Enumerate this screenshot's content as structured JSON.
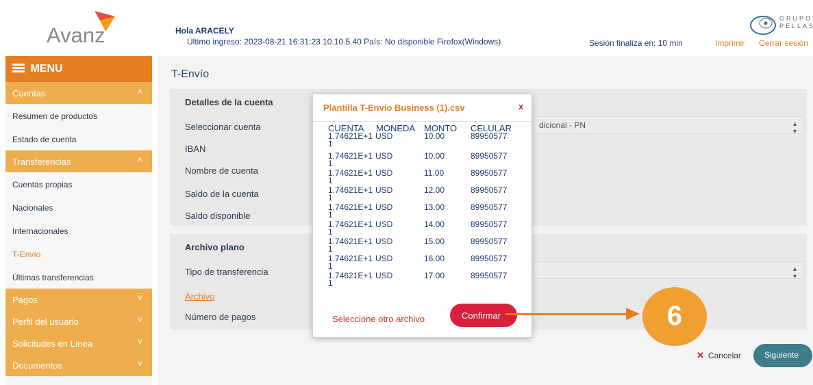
{
  "header": {
    "logo_text": "Avanz",
    "greeting": "Hola ARACELY",
    "last_login": "Último ingreso: 2023-08-21 16:31:23 10.10.5.40 País: No disponible Firefox(Windows)",
    "session": "Sesión finaliza en: 10 min",
    "print_link": "Imprimir",
    "logout_link": "Cerrar sesión",
    "group_logo_line1": "GRUPO",
    "group_logo_line2": "PELLAS"
  },
  "sidebar": {
    "menu_label": "MENU",
    "sections": [
      {
        "label": "Cuentas",
        "chevron": "^",
        "items": [
          "Resumen de productos",
          "Estado de cuenta"
        ]
      },
      {
        "label": "Transferencias",
        "chevron": "^",
        "items": [
          "Cuentas propias",
          "Nacionales",
          "Internacionales",
          "T-Envío",
          "Últimas transferencias"
        ]
      },
      {
        "label": "Pagos",
        "chevron": "v"
      },
      {
        "label": "Perfil del usuario",
        "chevron": "v"
      },
      {
        "label": "Solicitudes en Línea",
        "chevron": "v"
      },
      {
        "label": "Documentos",
        "chevron": "v"
      }
    ],
    "active_item": "T-Envío"
  },
  "main": {
    "title": "T-Envío",
    "account_panel": {
      "title": "Detalles de la cuenta",
      "labels": [
        "Seleccionar cuenta",
        "IBAN",
        "Nombre de cuenta",
        "Saldo de la cuenta",
        "Saldo disponible"
      ],
      "account_select_value": "dicional - PN"
    },
    "file_panel": {
      "title": "Archivo plano",
      "transfer_type_label": "Tipo de transferencia",
      "file_label": "Archivo",
      "payments_label": "Número de pagos"
    },
    "cancel_label": "Cancelar",
    "next_label": "Siguiente"
  },
  "modal": {
    "title": "Plantilla T-Envío Business (1).csv",
    "close": "x",
    "columns": [
      "CUENTA",
      "MONEDA",
      "MONTO",
      "CELULAR"
    ],
    "rows": [
      {
        "account": "1.74621E+1",
        "suffix": "1",
        "currency": "USD",
        "amount": "10.00",
        "phone": "89950577"
      },
      {
        "account": "1.74621E+1",
        "suffix": "1",
        "currency": "USD",
        "amount": "10.00",
        "phone": "89950577"
      },
      {
        "account": "1.74621E+1",
        "suffix": "1",
        "currency": "USD",
        "amount": "11.00",
        "phone": "89950577"
      },
      {
        "account": "1.74621E+1",
        "suffix": "1",
        "currency": "USD",
        "amount": "12.00",
        "phone": "89950577"
      },
      {
        "account": "1.74621E+1",
        "suffix": "1",
        "currency": "USD",
        "amount": "13.00",
        "phone": "89950577"
      },
      {
        "account": "1.74621E+1",
        "suffix": "1",
        "currency": "USD",
        "amount": "14.00",
        "phone": "89950577"
      },
      {
        "account": "1.74621E+1",
        "suffix": "1",
        "currency": "USD",
        "amount": "15.00",
        "phone": "89950577"
      },
      {
        "account": "1.74621E+1",
        "suffix": "1",
        "currency": "USD",
        "amount": "16.00",
        "phone": "89950577"
      },
      {
        "account": "1.74621E+1",
        "suffix": "1",
        "currency": "USD",
        "amount": "17.00",
        "phone": "89950577"
      }
    ],
    "other_file": "Seleccione otro archivo",
    "confirm": "Confirmar"
  },
  "annotation": {
    "step": "6"
  },
  "colors": {
    "brand_orange": "#e67e22",
    "section_orange": "#f0ad4e",
    "confirm_red": "#d9203a",
    "next_teal": "#3d7d8c"
  }
}
